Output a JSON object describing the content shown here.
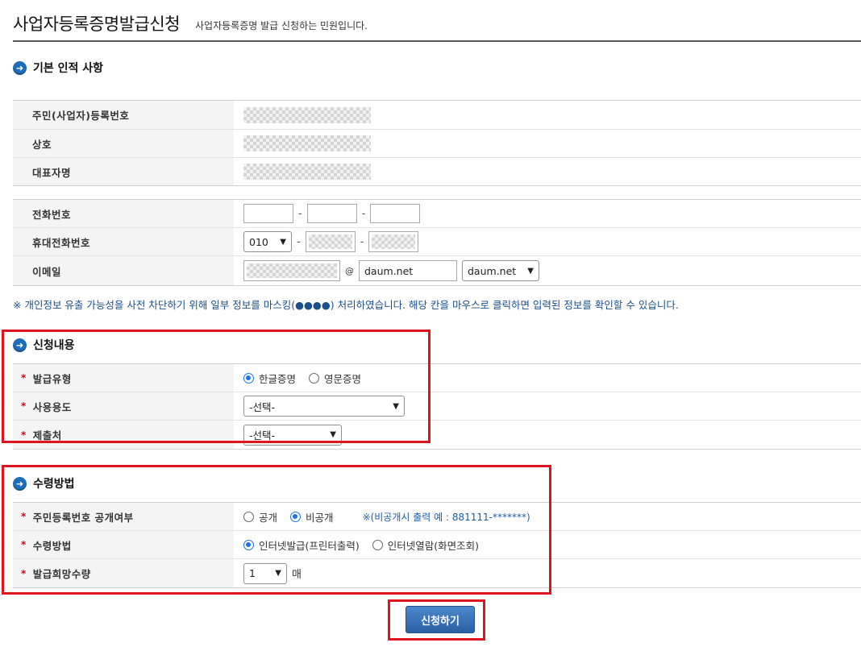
{
  "header": {
    "title": "사업자등록증명발급신청",
    "subtitle": "사업자등록증명 발급 신청하는 민원입니다."
  },
  "basic": {
    "section_title": "기본 인적 사항",
    "rows": [
      {
        "label": "주민(사업자)등록번호"
      },
      {
        "label": "상호"
      },
      {
        "label": "대표자명"
      }
    ]
  },
  "contact": {
    "phone_label": "전화번호",
    "phone_values": [
      "",
      "",
      ""
    ],
    "mobile_label": "휴대전화번호",
    "mobile_prefix": "010",
    "email_label": "이메일",
    "email_at": "@",
    "email_domain": "daum.net",
    "email_domain_select": "daum.net",
    "dash": "-"
  },
  "notice": "※ 개인정보 유출 가능성을 사전 차단하기 위해 일부 정보를 마스킹(●●●●) 처리하였습니다. 해당 칸을 마우스로 클릭하면 입력된 정보를 확인할 수 있습니다.",
  "application": {
    "section_title": "신청내용",
    "required_mark": "*",
    "issue_type_label": "발급유형",
    "issue_type_options": [
      "한글증명",
      "영문증명"
    ],
    "issue_type_selected": "한글증명",
    "usage_label": "사용용도",
    "usage_value": "-선택-",
    "submit_to_label": "제출처",
    "submit_to_value": "-선택-"
  },
  "receipt": {
    "section_title": "수령방법",
    "disclose_label": "주민등록번호 공개여부",
    "disclose_options": [
      "공개",
      "비공개"
    ],
    "disclose_selected": "비공개",
    "disclose_hint": "※(비공개시 출력 예 : 881111-*******)",
    "method_label": "수령방법",
    "method_options": [
      "인터넷발급(프린터출력)",
      "인터넷열람(화면조회)"
    ],
    "method_selected": "인터넷발급(프린터출력)",
    "count_label": "발급희망수량",
    "count_value": "1",
    "count_unit": "매"
  },
  "submit_label": "신청하기",
  "icons": {
    "section": "arrow-circle-icon",
    "select": "chevron-down-icon"
  },
  "colors": {
    "accent": "#1e6fb8",
    "highlight": "#e0141e",
    "required": "#d0021b"
  }
}
